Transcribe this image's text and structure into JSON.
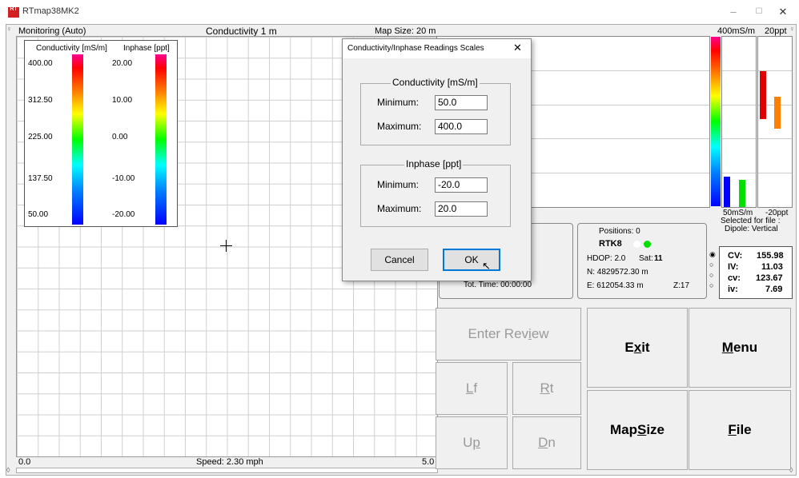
{
  "window": {
    "title": "RTmap38MK2",
    "minimize": "–",
    "maximize": "☐",
    "close": "✕",
    "icon_text": "RT"
  },
  "map": {
    "mode": "Monitoring (Auto)",
    "layer": "Conductivity 1 m",
    "map_size": "Map Size:  20 m",
    "x_start": "0.0",
    "x_end": "5.0",
    "speed": "Speed:  2.30 mph"
  },
  "legend": {
    "conductivity_title": "Conductivity [mS/m]",
    "inphase_title": "Inphase [ppt]",
    "conductivity_ticks": [
      "400.00",
      "312.50",
      "225.00",
      "137.50",
      "50.00"
    ],
    "inphase_ticks": [
      "20.00",
      "10.00",
      "0.00",
      "-10.00",
      "-20.00"
    ]
  },
  "bars": {
    "cond_top": "400mS/m",
    "inph_top": "20ppt",
    "cond_bottom": "50mS/m",
    "inph_bottom": "-20ppt",
    "selected": "Selected for file :",
    "dipole": "Dipole: Vertical",
    "cv_level": 0.18,
    "cv2_level": 0.16,
    "iv_level": 0.8,
    "iv2_level": 0.65,
    "colors": {
      "cv": "#0000ff",
      "cv2": "#00e000",
      "iv": "#e00000",
      "iv2": "#ff8000"
    }
  },
  "status": {
    "tot_time": "Tot. Time:  00:00:00"
  },
  "gps": {
    "positions": "Positions:  0",
    "rtk": "RTK8",
    "hdop": "HDOP: 2.0",
    "sat_label": "Sat:",
    "sat_value": "11",
    "north": "N:  4829572.30 m",
    "east": "E:  612054.33 m",
    "zone": "Z:17"
  },
  "readings": [
    {
      "label": "CV:",
      "value": "155.98",
      "selected": true
    },
    {
      "label": "IV:",
      "value": "11.03",
      "selected": false
    },
    {
      "label": "cv:",
      "value": "123.67",
      "selected": false
    },
    {
      "label": "iv:",
      "value": "7.69",
      "selected": false
    }
  ],
  "buttons": {
    "enter_review": "Enter Review",
    "exit": "Exit",
    "menu": "Menu",
    "left": "Lf",
    "right": "Rt",
    "map_size": "Map Size",
    "file": "File",
    "up": "Up",
    "down": "Dn"
  },
  "dialog": {
    "title": "Conductivity/Inphase Readings Scales",
    "cond_group": "Conductivity [mS/m]",
    "inph_group": "Inphase [ppt]",
    "min_label": "Minimum:",
    "max_label": "Maximum:",
    "cond_min": "50.0",
    "cond_max": "400.0",
    "inph_min": "-20.0",
    "inph_max": "20.0",
    "cancel": "Cancel",
    "ok": "OK",
    "close": "✕"
  }
}
